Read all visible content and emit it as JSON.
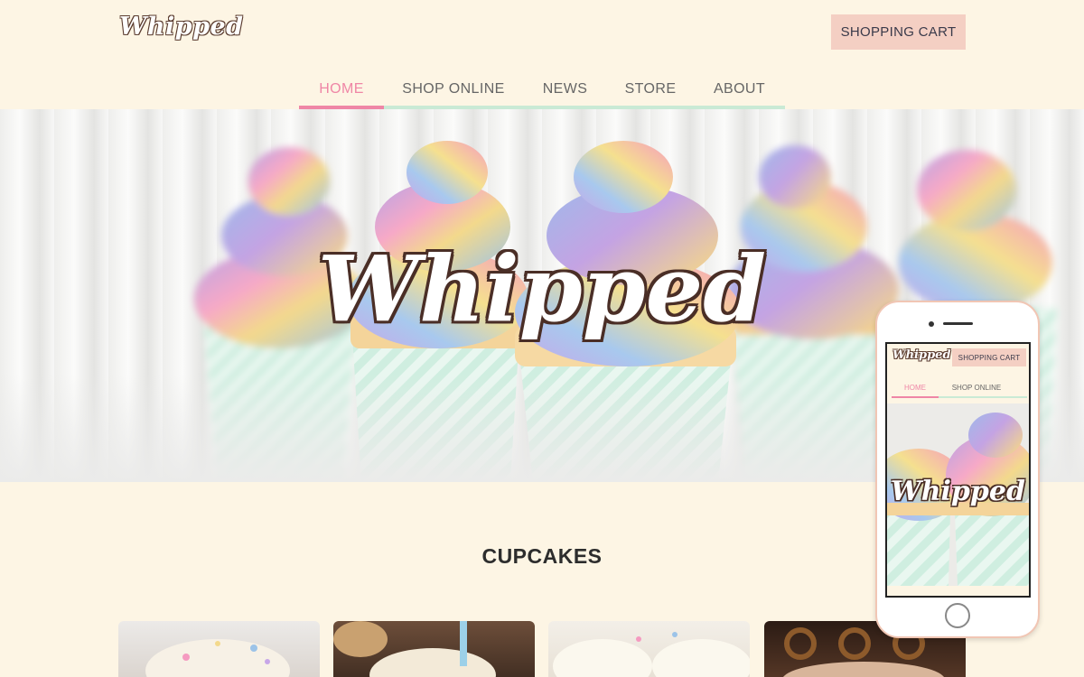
{
  "header": {
    "logo_text": "Whipped",
    "cart_label": "SHOPPING CART"
  },
  "nav": {
    "items": [
      {
        "label": "HOME",
        "active": true
      },
      {
        "label": "SHOP ONLINE",
        "active": false
      },
      {
        "label": "NEWS",
        "active": false
      },
      {
        "label": "STORE",
        "active": false
      },
      {
        "label": "ABOUT",
        "active": false
      }
    ]
  },
  "hero": {
    "title": "Whipped"
  },
  "section": {
    "title": "CUPCAKES"
  },
  "mobile_preview": {
    "logo_text": "Whipped",
    "cart_label": "SHOPPING CART",
    "nav_items": [
      "HOME",
      "SHOP ONLINE"
    ],
    "hero_title": "Whipped"
  },
  "colors": {
    "background": "#fdf5e4",
    "accent_pink": "#ef86a6",
    "nav_underline_mint": "#c9ead5",
    "cart_button": "#f4cfc3"
  }
}
